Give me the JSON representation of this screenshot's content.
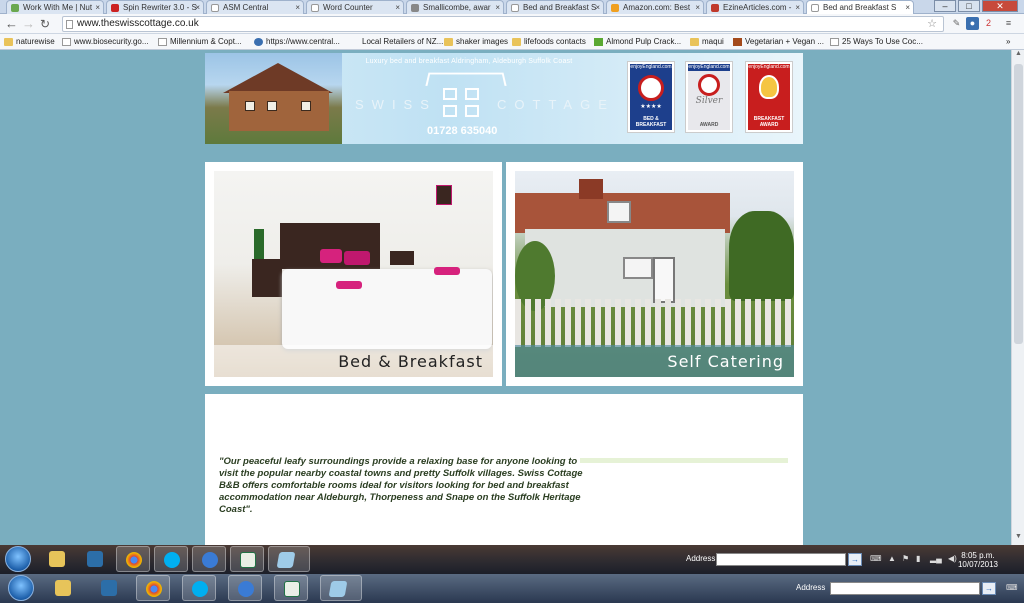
{
  "browser": {
    "tabs": [
      {
        "title": "Work With Me | Nut",
        "color": "#6aa84f"
      },
      {
        "title": "Spin Rewriter 3.0 - S",
        "color": "#cc2222"
      },
      {
        "title": "ASM Central",
        "color": "#ffffff"
      },
      {
        "title": "Word Counter",
        "color": "#ffffff"
      },
      {
        "title": "Smallicombe, awar",
        "color": "#888888"
      },
      {
        "title": "Bed and Breakfast S",
        "color": "#ffffff"
      },
      {
        "title": "Amazon.com: Best",
        "color": "#f0a020"
      },
      {
        "title": "EzineArticles.com -",
        "color": "#c0392b"
      },
      {
        "title": "Bed and Breakfast S",
        "color": "#ffffff"
      }
    ],
    "url": "www.theswisscottage.co.uk",
    "bookmarks": [
      {
        "label": "naturewise",
        "icon": "folder"
      },
      {
        "label": "www.biosecurity.go...",
        "icon": "page"
      },
      {
        "label": "Millennium & Copt...",
        "icon": "page"
      },
      {
        "label": "https://www.central...",
        "icon": "globe"
      },
      {
        "label": "Local Retailers of NZ...",
        "icon": "page"
      },
      {
        "label": "shaker images",
        "icon": "folder"
      },
      {
        "label": "lifefoods contacts",
        "icon": "folder"
      },
      {
        "label": "Almond Pulp Crack...",
        "icon": "green"
      },
      {
        "label": "maqui",
        "icon": "folder"
      },
      {
        "label": "Vegetarian + Vegan ...",
        "icon": "brown"
      },
      {
        "label": "25 Ways To Use Coc...",
        "icon": "page"
      }
    ],
    "overflow": "»"
  },
  "site": {
    "tagline": "Luxury bed and breakfast Aldringham, Aldeburgh Suffolk Coast",
    "brand_left": "SWISS",
    "brand_right": "COTTAGE",
    "phone": "01728 635040",
    "awards": [
      {
        "top": "enjoyEngland.com",
        "bottom": "BED & BREAKFAST",
        "color": "#c81e1e",
        "stars": "★★★★"
      },
      {
        "top": "enjoyEngland.com",
        "bottom": "AWARD",
        "color": "#c81e1e",
        "italic": "Silver"
      },
      {
        "top": "enjoyEngland.com",
        "bottom": "BREAKFAST AWARD",
        "color": "#c81e1e"
      }
    ],
    "cards": [
      {
        "caption": "Bed & Breakfast"
      },
      {
        "caption": "Self Catering"
      }
    ],
    "quote": "\"Our peaceful leafy surroundings provide a relaxing base for anyone looking to visit the popular nearby coastal towns and pretty Suffolk villages. Swiss Cottage B&B offers comfortable rooms ideal for visitors looking for bed and breakfast accommodation near Aldeburgh, Thorpeness and Snape on the Suffolk Heritage Coast\"."
  },
  "taskbar": {
    "address_label": "Address",
    "time": "8:05 p.m.",
    "date": "10/07/2013"
  }
}
